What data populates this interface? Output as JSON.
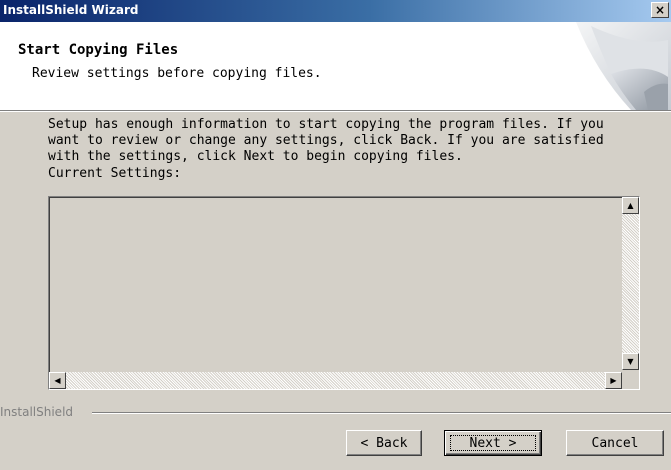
{
  "window": {
    "title": "InstallShield Wizard",
    "close_label": "×"
  },
  "header": {
    "title": "Start Copying Files",
    "subtitle": "Review settings before copying files."
  },
  "body": {
    "description": "Setup has enough information to start copying the program files.  If you\nwant to review or change any settings, click Back.  If you are satisfied\nwith the settings, click Next to begin copying files.",
    "settings_label": "Current Settings:",
    "settings_text": ""
  },
  "scrollbar": {
    "up_arrow": "▲",
    "down_arrow": "▼",
    "left_arrow": "◀",
    "right_arrow": "▶"
  },
  "footer": {
    "brand": "InstallShield",
    "back_label": "< Back",
    "next_label": "Next >",
    "cancel_label": "Cancel"
  },
  "colors": {
    "titlebar_start": "#0a246a",
    "titlebar_end": "#a6caf0",
    "face": "#d4d0c8"
  }
}
